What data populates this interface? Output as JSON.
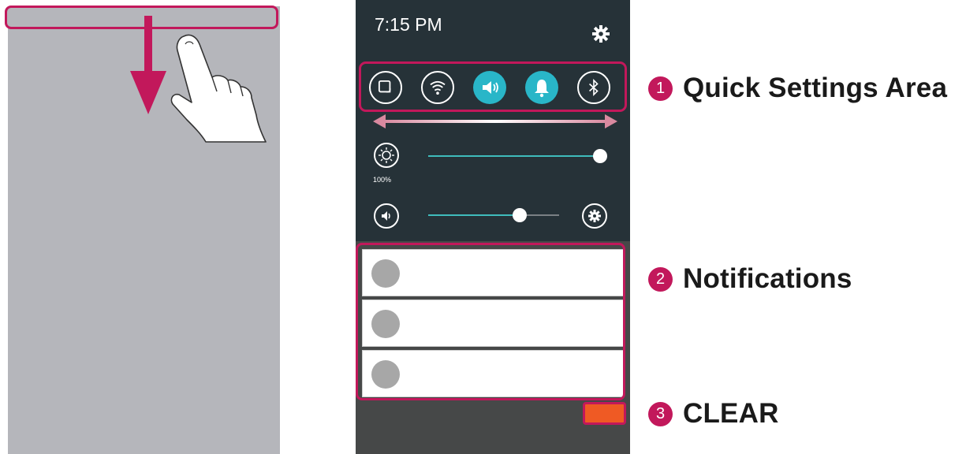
{
  "left_panel": {
    "icons": [
      "swipe-down-arrow-icon",
      "pointing-hand-icon"
    ]
  },
  "phone": {
    "time": "7:15 PM",
    "quick_settings": [
      {
        "name": "capture-icon",
        "state": "off"
      },
      {
        "name": "wifi-icon",
        "state": "off"
      },
      {
        "name": "sound-icon",
        "state": "on"
      },
      {
        "name": "notification-bell-icon",
        "state": "on"
      },
      {
        "name": "bluetooth-icon",
        "state": "off"
      }
    ],
    "brightness": {
      "label": "100%",
      "level": 1.0
    },
    "volume": {
      "level": 0.7
    },
    "notifications_count": 3
  },
  "callouts": [
    {
      "number": "1",
      "label": "Quick Settings Area"
    },
    {
      "number": "2",
      "label": "Notifications"
    },
    {
      "number": "3",
      "label": "CLEAR"
    }
  ],
  "colors": {
    "accent": "#c2185b",
    "toggle_on": "#29b6c8",
    "clear_button": "#ef5a24",
    "panel": "#263238"
  }
}
